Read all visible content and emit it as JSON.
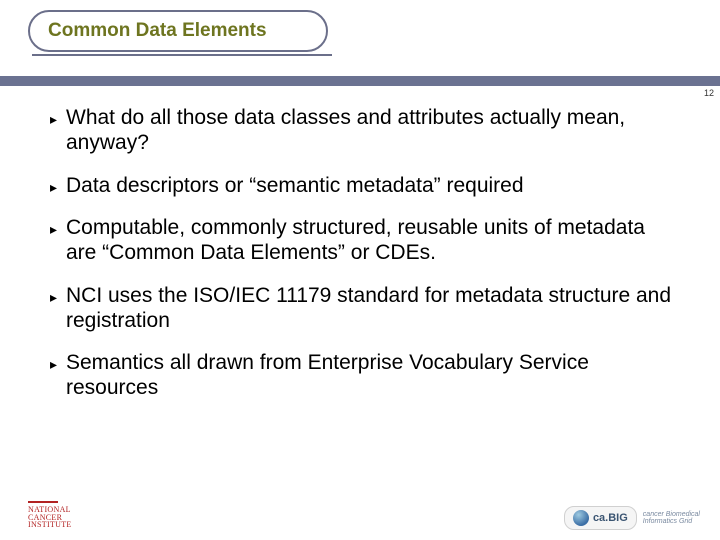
{
  "title": "Common Data Elements",
  "page_number": "12",
  "bullets": [
    "What do all those data classes and attributes actually mean, anyway?",
    "Data descriptors or “semantic metadata” required",
    "Computable, commonly structured, reusable units of metadata are “Common Data Elements” or CDEs.",
    "NCI uses the ISO/IEC 11179 standard for metadata structure and registration",
    "Semantics all drawn from Enterprise Vocabulary Service resources"
  ],
  "footer": {
    "left_logo_lines": [
      "NATIONAL",
      "CANCER",
      "INSTITUTE"
    ],
    "right_badge": "ca.BIG",
    "right_sub1": "cancer Biomedical",
    "right_sub2": "Informatics Grid"
  }
}
